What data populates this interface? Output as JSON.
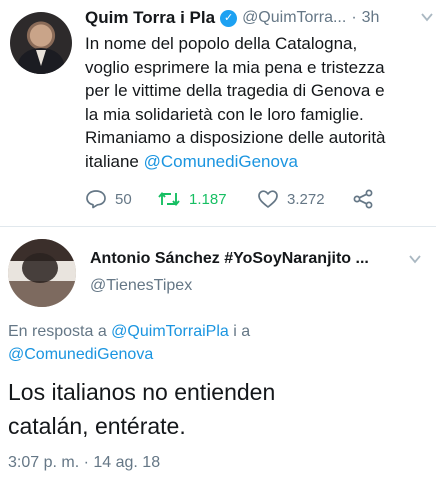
{
  "tweet": {
    "author_name": "Quim Torra i Pla",
    "author_handle": "@QuimTorra...",
    "separator": "·",
    "time": "3h",
    "text_lines": [
      "In nome del popolo della Catalogna,",
      "voglio esprimere la mia pena e tristezza",
      "per le vittime della tragedia di Genova e",
      "la mia solidarietà con le loro famiglie.",
      "Rimaniamo a disposizione delle autorità",
      "italiane "
    ],
    "mention": "@ComunediGenova",
    "replies": "50",
    "retweets": "1.187",
    "likes": "3.272",
    "accent_color": "#1da1f2",
    "retweet_color": "#17bf63"
  },
  "reply_tweet": {
    "author_name": "Antonio Sánchez #YoSoyNaranjito ...",
    "author_handle": "@TienesTipex",
    "reply_prefix": "En resposta a ",
    "reply_mention_1": "@QuimTorraiPla",
    "reply_joiner": " i a",
    "reply_mention_2": "@ComunediGenova",
    "text_line_1": "Los italianos no entienden",
    "text_line_2": "catalán, entérate.",
    "timestamp": "3:07 p. m. · 14 ag. 18"
  }
}
